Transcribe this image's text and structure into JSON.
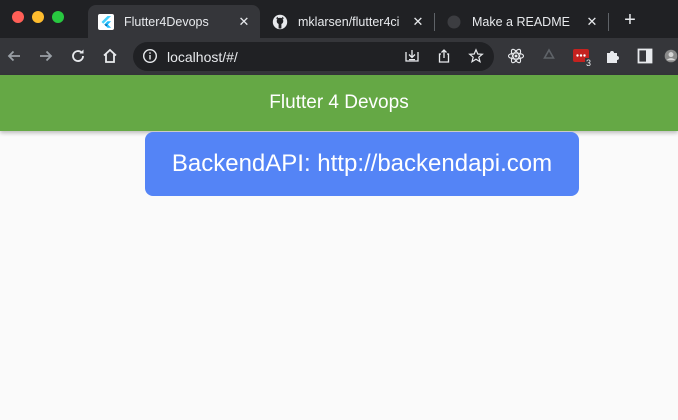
{
  "browser": {
    "window_controls": {
      "close_color": "#ff5f57",
      "minimize_color": "#febc2e",
      "maximize_color": "#28c840"
    },
    "tabs": [
      {
        "title": "Flutter4Devops",
        "favicon": "flutter-icon",
        "active": true
      },
      {
        "title": "mklarsen/flutter4ci",
        "favicon": "github-icon",
        "active": false
      },
      {
        "title": "Make a README",
        "favicon": "blank-page-icon",
        "active": false
      }
    ],
    "new_tab_label": "+",
    "toolbar": {
      "url": "localhost/#/",
      "extension_badge": "3",
      "icons": [
        "back-arrow-icon",
        "forward-arrow-icon",
        "reload-icon",
        "home-icon",
        "site-info-icon",
        "install-app-icon",
        "share-icon",
        "bookmark-star-icon",
        "react-devtools-icon",
        "recycle-extension-icon",
        "message-extension-icon",
        "extensions-puzzle-icon",
        "side-panel-icon",
        "profile-avatar"
      ]
    }
  },
  "app": {
    "title": "Flutter 4 Devops",
    "backend_label": "BackendAPI: http://backendapi.com",
    "colors": {
      "appbar": "#65a845",
      "card": "#5484f6",
      "background": "#fafafa"
    }
  }
}
